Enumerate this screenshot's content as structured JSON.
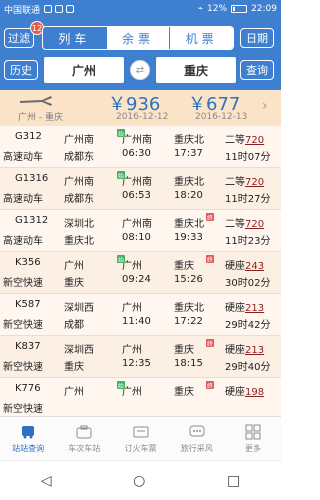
{
  "status": {
    "carrier": "中国联通",
    "time": "22:09",
    "battery": "12%"
  },
  "header": {
    "filter": "过滤",
    "filter_badge": "12",
    "tabs": [
      {
        "label": "列车"
      },
      {
        "label": "余票"
      },
      {
        "label": "机票"
      }
    ],
    "date": "日期",
    "history": "历史",
    "query": "查询",
    "from": "广州",
    "to": "重庆",
    "swap": "⇄"
  },
  "price": {
    "route": "广州 - 重庆",
    "p1": "￥936",
    "d1": "2016-12-12",
    "p2": "￥677",
    "d2": "2016-12-13"
  },
  "rows": [
    {
      "train": "G312",
      "type": "高速动车",
      "s1": "广州南",
      "s2": "成都东",
      "t1": "广州南",
      "time1": "06:30",
      "s3": "重庆北",
      "time2": "17:37",
      "seat": "二等",
      "num": "720",
      "dur": "11时07分",
      "mark_start": "始"
    },
    {
      "train": "G1316",
      "type": "高速动车",
      "s1": "广州南",
      "s2": "成都东",
      "t1": "广州南",
      "time1": "06:53",
      "s3": "重庆北",
      "time2": "18:20",
      "seat": "二等",
      "num": "720",
      "dur": "11时27分",
      "mark_start": "始"
    },
    {
      "train": "G1312",
      "type": "高速动车",
      "s1": "深圳北",
      "s2": "重庆北",
      "t1": "广州南",
      "time1": "08:10",
      "s3": "重庆北",
      "time2": "19:33",
      "seat": "二等",
      "num": "720",
      "dur": "11时23分",
      "mark_end": "终"
    },
    {
      "train": "K356",
      "type": "新空快速",
      "s1": "广州",
      "s2": "重庆",
      "t1": "广州",
      "time1": "09:24",
      "s3": "重庆",
      "time2": "15:26",
      "seat": "硬座",
      "num": "243",
      "dur": "30时02分",
      "mark_start": "始",
      "mark_end": "终"
    },
    {
      "train": "K587",
      "type": "新空快速",
      "s1": "深圳西",
      "s2": "成都",
      "t1": "广州",
      "time1": "11:40",
      "s3": "重庆北",
      "time2": "17:22",
      "seat": "硬座",
      "num": "213",
      "dur": "29时42分"
    },
    {
      "train": "K837",
      "type": "新空快速",
      "s1": "深圳西",
      "s2": "重庆",
      "t1": "广州",
      "time1": "12:35",
      "s3": "重庆",
      "time2": "18:15",
      "seat": "硬座",
      "num": "213",
      "dur": "29时40分",
      "mark_end": "终"
    },
    {
      "train": "K776",
      "type": "新空快速",
      "s1": "广州",
      "s2": "",
      "t1": "广州",
      "time1": "",
      "s3": "重庆",
      "time2": "",
      "seat": "硬座",
      "num": "198",
      "dur": "",
      "mark_start": "始",
      "mark_end": "终"
    }
  ],
  "tabbar": [
    {
      "label": "站站查询"
    },
    {
      "label": "车次车站"
    },
    {
      "label": "订火车票"
    },
    {
      "label": "旅行采风"
    },
    {
      "label": "更多"
    }
  ],
  "nav": {
    "back": "◁",
    "home": "○",
    "recent": "□"
  }
}
